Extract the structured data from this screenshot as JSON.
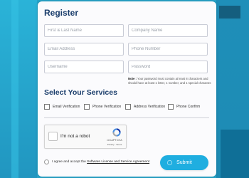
{
  "form": {
    "title": "Register",
    "fields": {
      "full_name": {
        "placeholder": "First & Last Name",
        "value": ""
      },
      "company": {
        "placeholder": "Company Name",
        "value": ""
      },
      "email": {
        "placeholder": "Email Address",
        "value": ""
      },
      "phone": {
        "placeholder": "Phone Number",
        "value": ""
      },
      "username": {
        "placeholder": "Username",
        "value": ""
      },
      "password": {
        "placeholder": "Password",
        "value": ""
      }
    },
    "note_label": "Note :",
    "note_text": "Your password must contain at least 8 characters and should have at least 1 letter, 1 number, and 1 special character."
  },
  "services": {
    "title": "Select Your Services",
    "items": [
      {
        "label": "Email Verification",
        "checked": false
      },
      {
        "label": "Phone Verification",
        "checked": false
      },
      {
        "label": "Address Verification",
        "checked": false
      },
      {
        "label": "Phone Confirm",
        "checked": false
      }
    ]
  },
  "captcha": {
    "label": "I'm not a robot",
    "brand": "reCAPTCHA",
    "links": "Privacy - Terms"
  },
  "agreement": {
    "prefix": "I agree and accept the",
    "link_text": "Software License and Service Agreement",
    "checked": false
  },
  "submit": {
    "label": "Submit"
  },
  "colors": {
    "background": "#27a3c8",
    "heading": "#1a3d6b",
    "submit": "#1faee0"
  }
}
